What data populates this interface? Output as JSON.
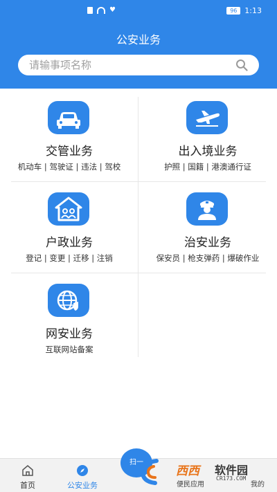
{
  "status_bar": {
    "battery": "96",
    "time": "1:13"
  },
  "header": {
    "title": "公安业务",
    "search_placeholder": "请输事项名称"
  },
  "services": [
    {
      "title": "交管业务",
      "subtitle": "机动车 | 驾驶证 | 违法 | 驾校",
      "icon": "car-icon"
    },
    {
      "title": "出入境业务",
      "subtitle": "护照 | 国籍 | 港澳通行证",
      "icon": "airplane-icon"
    },
    {
      "title": "户政业务",
      "subtitle": "登记 | 变更 | 迁移 | 注销",
      "icon": "household-icon"
    },
    {
      "title": "治安业务",
      "subtitle": "保安员 | 枪支弹药 | 爆破作业",
      "icon": "police-officer-icon"
    },
    {
      "title": "网安业务",
      "subtitle": "互联网站备案",
      "icon": "globe-lock-icon"
    }
  ],
  "bottom_nav": {
    "home": "首页",
    "police_services": "公安业务",
    "scan": "扫一",
    "convenience_partial": "便民应用",
    "mine_partial": "我的"
  },
  "watermark": {
    "text_a": "西西",
    "text_b": "软件园",
    "url": "CR173.COM"
  },
  "colors": {
    "primary": "#2f86e8",
    "accent_orange": "#e8741a"
  }
}
